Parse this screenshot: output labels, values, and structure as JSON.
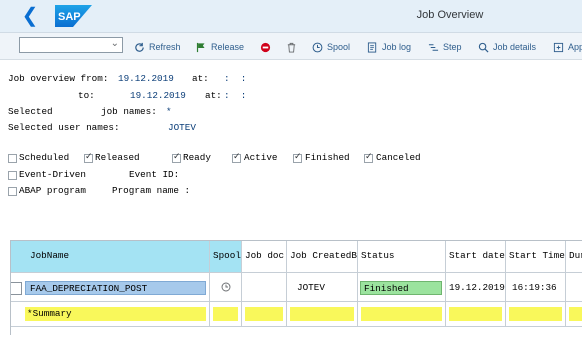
{
  "shell": {
    "title": "Job Overview",
    "logo_text": "SAP"
  },
  "toolbar": {
    "variant_value": "",
    "buttons": [
      {
        "label": "Refresh",
        "icon": "refresh-icon"
      },
      {
        "label": "Release",
        "icon": "flag-icon"
      },
      {
        "label": "",
        "icon": "stop-icon"
      },
      {
        "label": "",
        "icon": "trash-icon"
      },
      {
        "label": "Spool",
        "icon": "clock-icon"
      },
      {
        "label": "Job log",
        "icon": "log-icon"
      },
      {
        "label": "Step",
        "icon": "step-icon"
      },
      {
        "label": "Job details",
        "icon": "magnifier-icon"
      },
      {
        "label": "App",
        "icon": "app-icon"
      }
    ]
  },
  "criteria": {
    "from_label": "Job overview from:",
    "from_date": "19.12.2019",
    "at_label": "at:",
    "time_sep": ":  :",
    "to_label": "to:",
    "to_date": "19.12.2019",
    "selected_label": "Selected",
    "job_names_label": "job names:",
    "job_names_value": "*",
    "user_names_label": "Selected user names:",
    "user_names_value": "JOTEV"
  },
  "status_filters": [
    {
      "label": "Scheduled",
      "checked": false
    },
    {
      "label": "Released",
      "checked": true
    },
    {
      "label": "Ready",
      "checked": true
    },
    {
      "label": "Active",
      "checked": true
    },
    {
      "label": "Finished",
      "checked": true
    },
    {
      "label": "Canceled",
      "checked": true
    }
  ],
  "event": {
    "driven_label": "Event-Driven",
    "event_id_label": "Event ID:",
    "abap_label": "ABAP program",
    "program_name_label": "Program name :"
  },
  "grid": {
    "columns": [
      "JobName",
      "Spool",
      "Job doc",
      "Job CreatedB",
      "Status",
      "Start date",
      "Start Time",
      "Dura"
    ],
    "rows": [
      {
        "job_name": "FAA_DEPRECIATION_POST",
        "spool_icon": "clock-icon",
        "job_doc": "",
        "created_by": "JOTEV",
        "status": "Finished",
        "start_date": "19.12.2019",
        "start_time": "16:19:36",
        "duration": ""
      }
    ],
    "summary_label": "*Summary"
  },
  "colors": {
    "shell_bg": "#e4eff8",
    "accent": "#0a6ed1",
    "header_highlight": "#a4e3f3",
    "selected_row": "#a6c9eb",
    "status_finished": "#9be39e",
    "summary": "#f9f85b"
  }
}
